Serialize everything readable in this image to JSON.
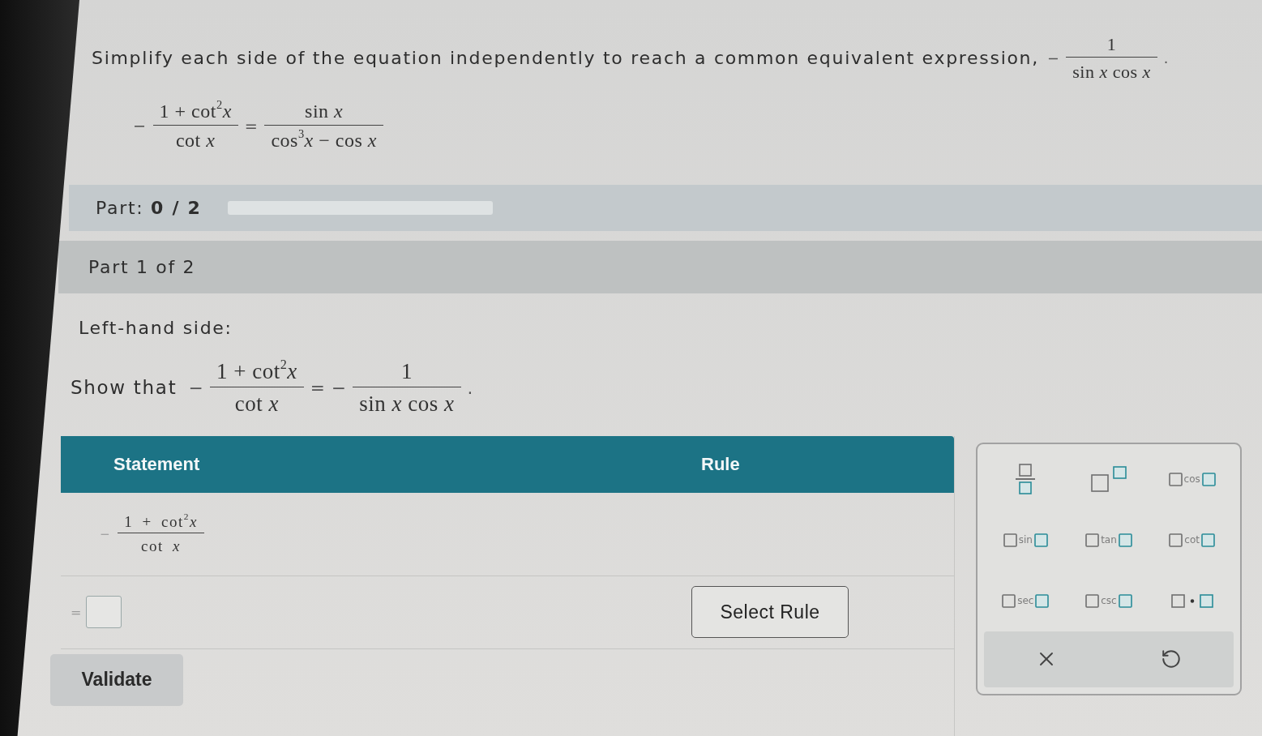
{
  "instruction": {
    "text": "Simplify each side of the equation independently to reach a common equivalent expression,",
    "expression": [
      {
        "kind": "text",
        "text": "−"
      },
      {
        "kind": "fraction",
        "numerator": "1",
        "denominator": "sin *x* cos *x*"
      },
      {
        "kind": "text",
        "text": "."
      }
    ]
  },
  "equation": [
    {
      "kind": "text",
      "text": "−"
    },
    {
      "kind": "fraction",
      "numerator": "1 + cot$^{2}$*x*",
      "denominator": "cot *x*"
    },
    {
      "kind": "text",
      "text": "="
    },
    {
      "kind": "fraction",
      "numerator": "sin *x*",
      "denominator": "cos$^{3}$*x* − cos *x*"
    }
  ],
  "progress": {
    "label": "Part: **0 / 2**",
    "level": 0
  },
  "part_header": "Part 1 of 2",
  "side_label": "Left-hand side:",
  "goal": {
    "lead": "Show that",
    "expression": [
      {
        "kind": "text",
        "text": "−"
      },
      {
        "kind": "fraction",
        "numerator": "1 + cot$^{2}$*x*",
        "denominator": "cot *x*"
      },
      {
        "kind": "text",
        "text": "= −"
      },
      {
        "kind": "fraction",
        "numerator": "1",
        "denominator": "sin *x* cos *x*"
      },
      {
        "kind": "text",
        "text": "."
      }
    ]
  },
  "proof_table": {
    "columns": [
      "Statement",
      "Rule"
    ],
    "rows": [
      {
        "kind": "given",
        "statement": [
          {
            "kind": "text",
            "text": "−"
          },
          {
            "kind": "fraction",
            "numerator": "1 + cot$^{2}$*x*",
            "denominator": "cot *x*"
          }
        ]
      },
      {
        "kind": "step",
        "relation": "=",
        "rule_button": "Select Rule"
      }
    ]
  },
  "validate_button": "Validate",
  "keypad": {
    "keys": [
      {
        "kind": "fraction"
      },
      {
        "kind": "power"
      },
      {
        "kind": "function",
        "label": "cos"
      },
      {
        "kind": "function",
        "label": "sin"
      },
      {
        "kind": "function",
        "label": "tan"
      },
      {
        "kind": "function",
        "label": "cot"
      },
      {
        "kind": "function",
        "label": "sec"
      },
      {
        "kind": "function",
        "label": "csc"
      },
      {
        "kind": "product"
      }
    ],
    "actions": [
      {
        "kind": "clear"
      },
      {
        "kind": "undo"
      }
    ]
  }
}
